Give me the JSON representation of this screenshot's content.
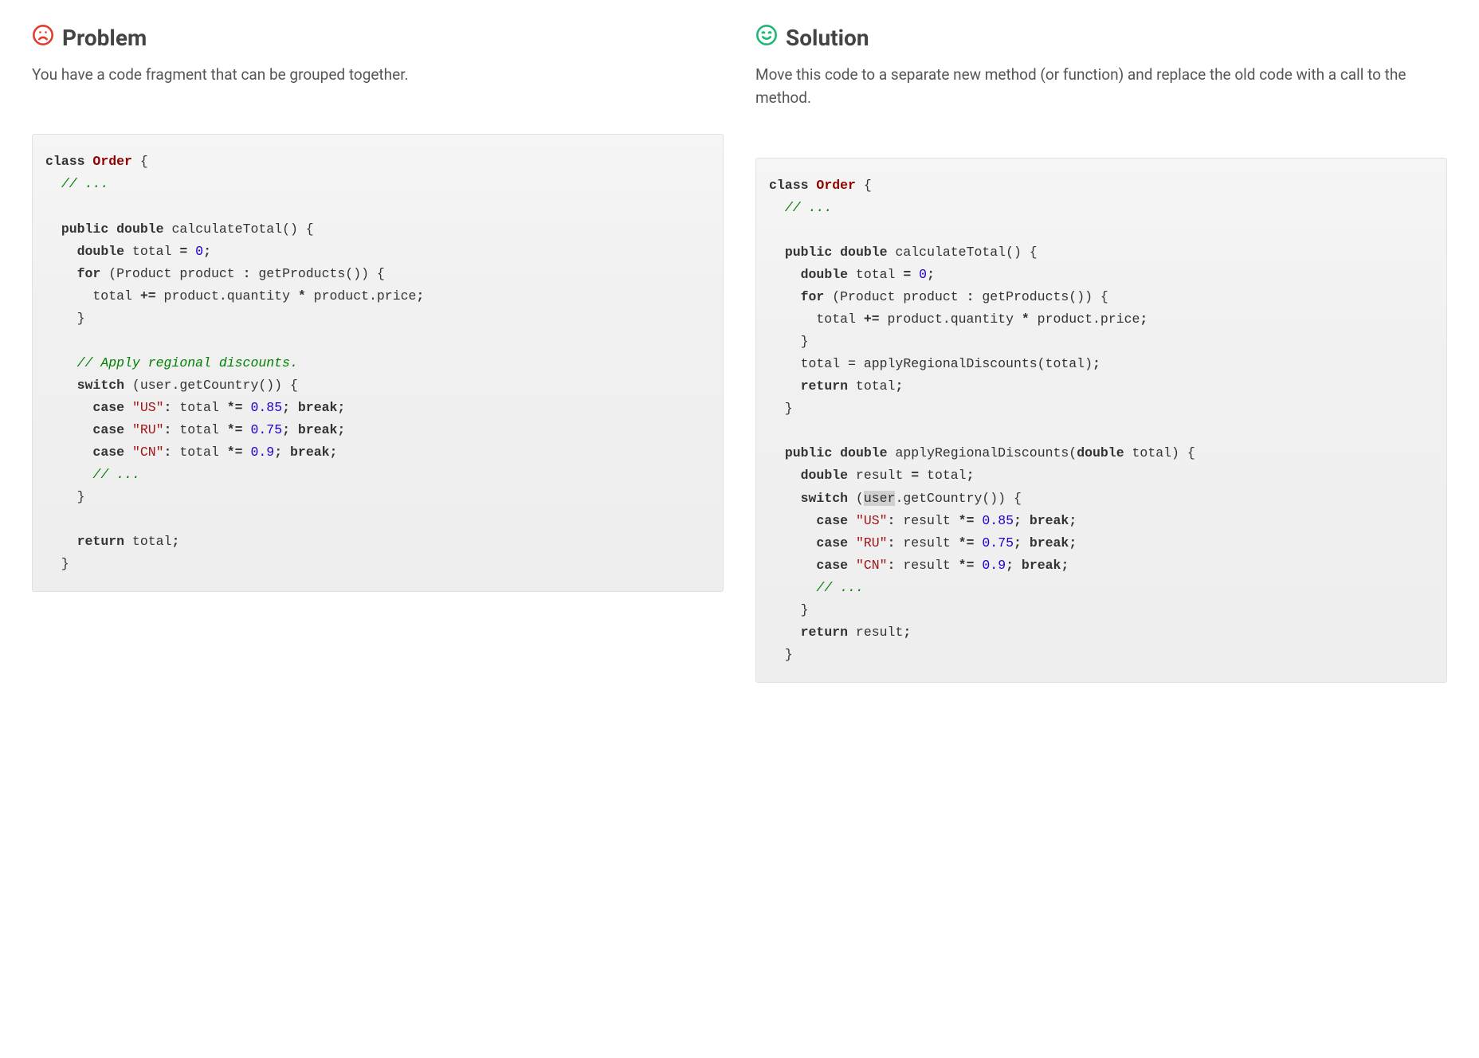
{
  "problem": {
    "heading": "Problem",
    "desc": "You have a code fragment that can be grouped together.",
    "code": {
      "kw_class": "class",
      "cls_name": "Order",
      "brace_open": " {",
      "com_dots": "// ...",
      "kw_public": "public",
      "kw_double": "double",
      "fn_calculateTotal": " calculateTotal",
      "paren_open_close_brace": "() {",
      "var_total": " total ",
      "op_eq": "=",
      "num_zero": "0",
      "semi": ";",
      "kw_for": "for",
      "for_rest1": " (Product product ",
      "op_colon": ":",
      "for_rest2": " getProducts()) {",
      "body_total_plus": "      total ",
      "op_pluseq": "+=",
      "body_product_expr": " product.quantity ",
      "op_star": "*",
      "body_price_end": " product.price",
      "brace_close_indent4": "    }",
      "com_regional": "// Apply regional discounts.",
      "kw_switch": "switch",
      "switch_rest": " (user.getCountry()) {",
      "kw_case": "case",
      "str_us": "\"US\"",
      "case_us_mid": " total ",
      "op_stareq": "*=",
      "num_085": "0.85",
      "kw_break": "break",
      "str_ru": "\"RU\"",
      "num_075": "0.75",
      "str_cn": "\"CN\"",
      "num_09": "0.9",
      "kw_return": "return",
      "return_total": " total",
      "brace_close_indent2": "  }"
    }
  },
  "solution": {
    "heading": "Solution",
    "desc": "Move this code to a separate new method (or function) and replace the old code with a call to the method.",
    "code": {
      "call_apply": "    total = applyRegionalDiscounts(total)",
      "fn_applyRegional": " applyRegionalDiscounts(",
      "param_total_end": " total) {",
      "result_decl": " result ",
      "result_eq_total": " total",
      "switch_open": " (",
      "hl_user": "user",
      "switch_rest2": ".getCountry()) {",
      "case_res_mid": " result ",
      "return_result": " result"
    }
  }
}
